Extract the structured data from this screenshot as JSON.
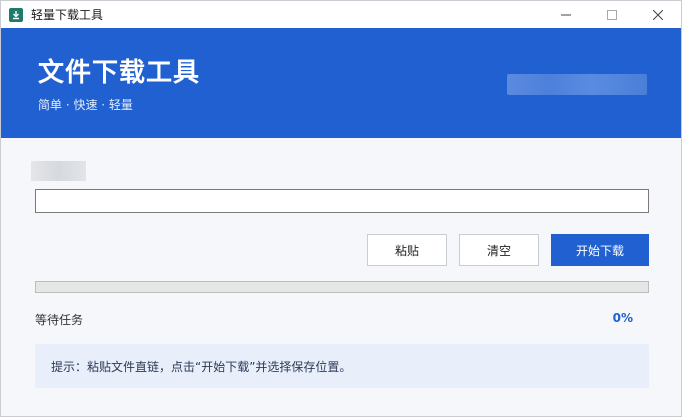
{
  "window": {
    "title": "轻量下载工具"
  },
  "banner": {
    "title": "文件下载工具",
    "subtitle": "简单 · 快速 · 轻量"
  },
  "form": {
    "url_value": ""
  },
  "buttons": {
    "paste": "粘贴",
    "clear": "清空",
    "start": "开始下载"
  },
  "progress": {
    "value": 0,
    "status": "等待任务",
    "percent_label": "0%"
  },
  "tip": {
    "text": "提示：粘贴文件直链，点击“开始下载”并选择保存位置。"
  },
  "colors": {
    "accent": "#2160d0",
    "background": "#f5f7fb"
  },
  "icons": {
    "app": "download-icon",
    "minimize": "minimize-icon",
    "maximize": "maximize-icon",
    "close": "close-icon"
  }
}
